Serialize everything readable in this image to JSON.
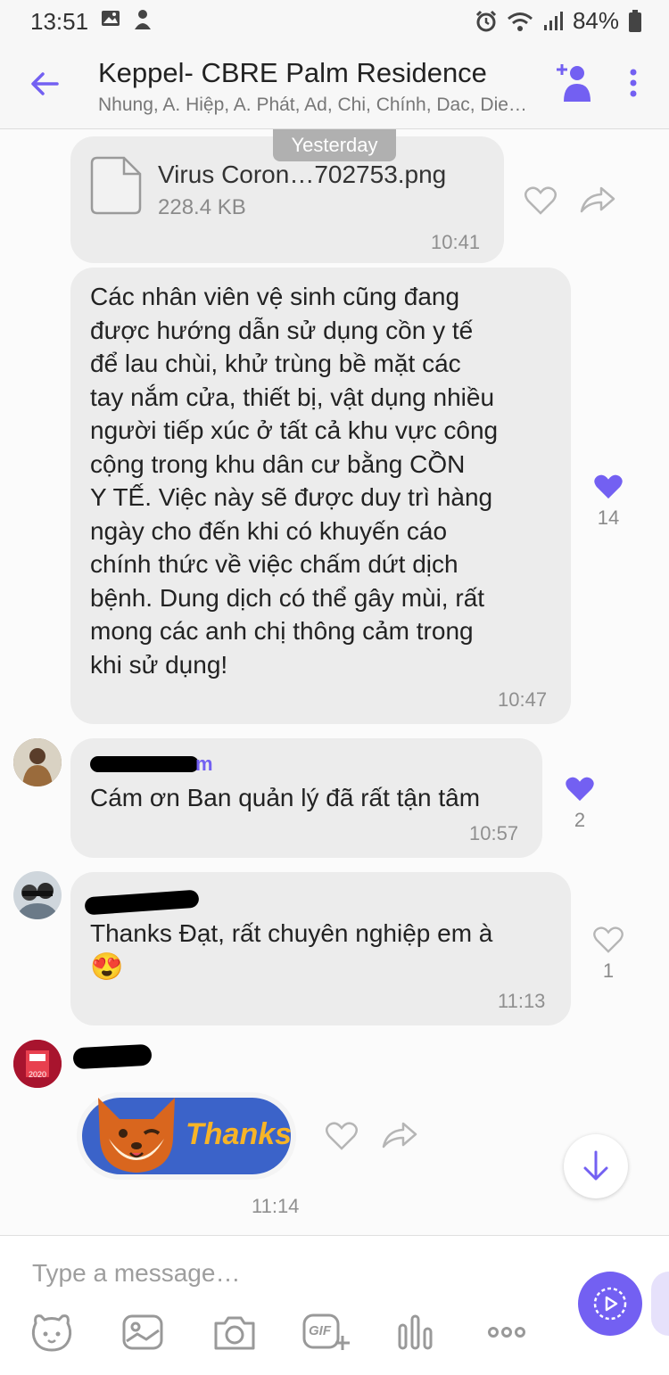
{
  "status_bar": {
    "time": "13:51",
    "battery": "84%"
  },
  "header": {
    "title": "Keppel- CBRE Palm Residence",
    "participants": "Nhung, A. Hiệp, A. Phát, Ad, Chi, Chính, Dac, Die…"
  },
  "day_divider": "Yesterday",
  "messages": {
    "file": {
      "name": "Virus Coron…702753.png",
      "size": "228.4 KB",
      "time": "10:41"
    },
    "announcement": {
      "lines": [
        "Các nhân viên vệ sinh cũng đang",
        "được hướng dẫn sử dụng cồn y tế",
        "để lau chùi, khử trùng bề mặt các",
        "tay nắm cửa, thiết bị, vật dụng nhiều",
        "người tiếp xúc ở tất cả khu vực công",
        "cộng trong khu dân cư bằng CỒN",
        "Y TẾ. Việc này sẽ được duy trì hàng",
        "ngày cho đến khi có khuyến cáo",
        "chính thức về việc chấm dứt dịch",
        "bệnh. Dung dịch có thể gây mùi, rất",
        "mong các anh chị thông cảm trong",
        "khi sử dụng!"
      ],
      "time": "10:47",
      "like_count": "14"
    },
    "reply1": {
      "sender_partial": "m",
      "text": "Cám ơn Ban quản lý đã rất tận tâm",
      "time": "10:57",
      "like_count": "2"
    },
    "reply2": {
      "text": "Thanks Đạt, rất chuyên nghiệp em à",
      "emoji": "😍",
      "time": "11:13",
      "like_count": "1"
    },
    "sticker": {
      "label": "Thanks",
      "time": "11:14",
      "avatar_text": "2020"
    }
  },
  "composer": {
    "placeholder": "Type a message…",
    "gif_label": "GIF"
  },
  "colors": {
    "accent": "#7360f2",
    "bubble": "#ececec",
    "timestamp": "#8f8f8f"
  }
}
